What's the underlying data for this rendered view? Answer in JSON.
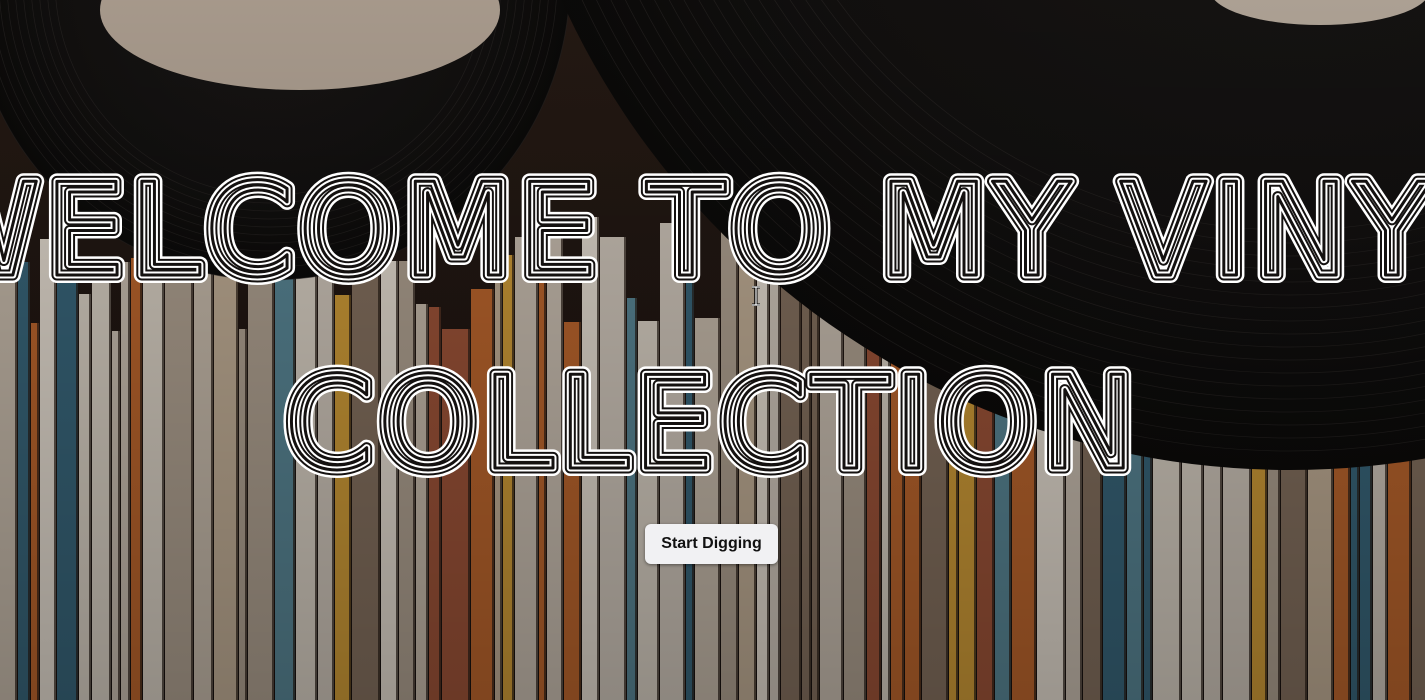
{
  "hero": {
    "headline_line1": "WELCOME TO MY VINYL",
    "headline_line2": "COLLECTION",
    "cta_label": "Start Digging",
    "background_image": "vinyl-records-background",
    "cursor_icon": "text-cursor-icon"
  },
  "colors": {
    "headline_stroke": "#ffffff",
    "button_bg": "#f1f1f3",
    "button_text": "#111111",
    "record_black": "#0f0d0c",
    "label_beige": "#c9b9a8"
  }
}
